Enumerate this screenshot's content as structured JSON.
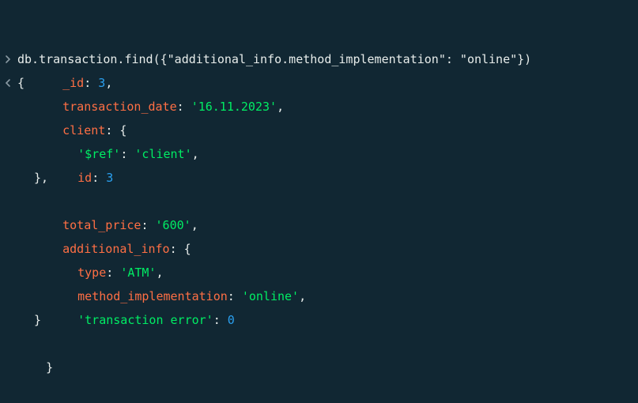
{
  "colors": {
    "background": "#112733",
    "key": "#ff6f44",
    "string": "#00ed64",
    "number": "#2aa0f0",
    "punctuation": "#e8edeb"
  },
  "prompt": {
    "input_icon": "chevron-right-icon",
    "output_icon": "chevron-left-icon",
    "command": "db.transaction.find({\"additional_info.method_implementation\": \"online\"})"
  },
  "result": {
    "open_brace": "{",
    "close_brace": "}",
    "fields": {
      "id_key": "_id",
      "id_value": "3",
      "date_key": "transaction_date",
      "date_value": "'16.11.2023'",
      "client_key": "client",
      "client": {
        "ref_key": "'$ref'",
        "ref_value": "'client'",
        "id_key": "id",
        "id_value": "3"
      },
      "total_key": "total_price",
      "total_value": "'600'",
      "info_key": "additional_info",
      "info": {
        "type_key": "type",
        "type_value": "'ATM'",
        "method_key": "method_implementation",
        "method_value": "'online'",
        "error_key": "'transaction error'",
        "error_value": "0"
      }
    }
  }
}
